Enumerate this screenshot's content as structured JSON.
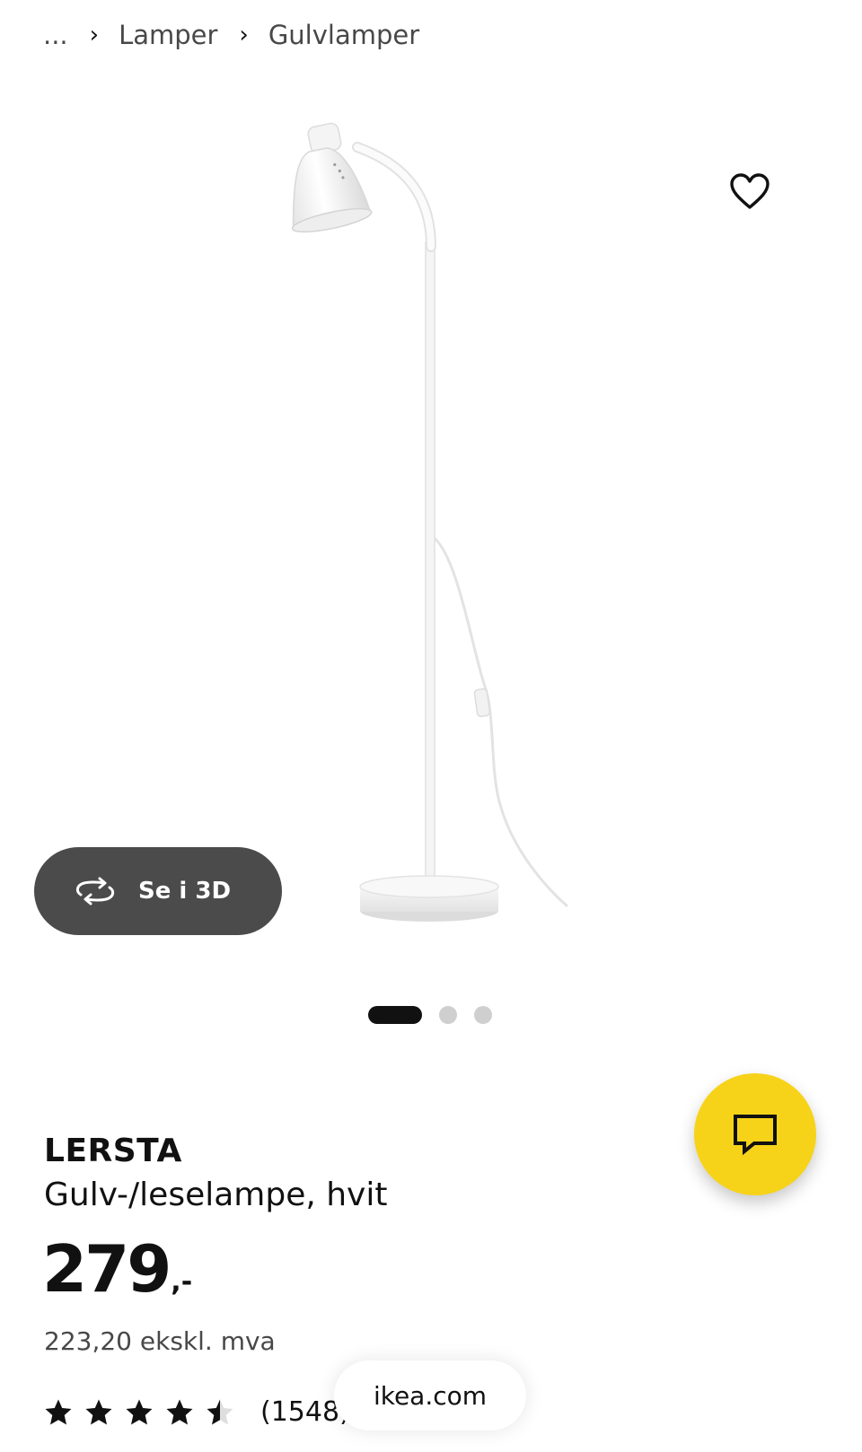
{
  "breadcrumb": {
    "ellipsis": "...",
    "items": [
      "Lamper",
      "Gulvlamper"
    ],
    "separator": "›"
  },
  "gallery": {
    "image_alt": "LERSTA Gulv-/leselampe, hvit",
    "view_3d_label": "Se i 3D",
    "slide_count": 3,
    "active_slide": 1
  },
  "product": {
    "name": "LERSTA",
    "description": "Gulv-/leselampe, hvit",
    "price_integer": "279",
    "price_suffix": ",-",
    "price_ex_vat": "223,20 ekskl. mva",
    "rating_value": 4.5,
    "rating_max": 5,
    "rating_count": "(1548)"
  },
  "browser": {
    "url_label": "ikea.com"
  },
  "icons": {
    "favorite": "heart-outline-icon",
    "view_3d": "rotate-3d-icon",
    "chat": "chat-bubble-icon",
    "star": "star-icon"
  },
  "colors": {
    "chat_fab": "#f6d319",
    "view_3d_button": "#4b4b4b",
    "active_dot": "#111111",
    "inactive_dot": "#cfcfcf"
  }
}
